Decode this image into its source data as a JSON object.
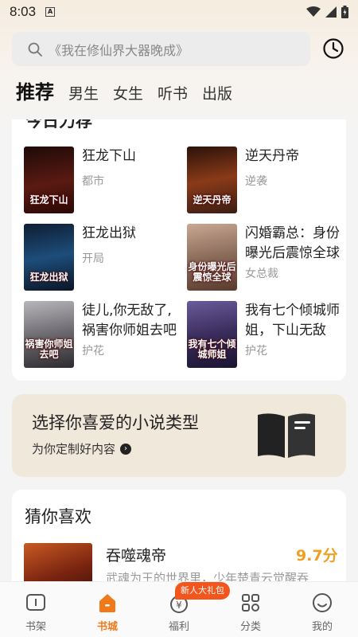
{
  "status_bar": {
    "time": "8:03"
  },
  "search": {
    "placeholder": "《我在修仙界大器晚成》"
  },
  "tabs": [
    {
      "label": "推荐",
      "active": true
    },
    {
      "label": "男生"
    },
    {
      "label": "女生"
    },
    {
      "label": "听书"
    },
    {
      "label": "出版"
    }
  ],
  "ranking": {
    "title": "今日力荐",
    "books": [
      {
        "title": "狂龙下山",
        "tag": "都市",
        "cover_text": "狂龙下山",
        "cover_color": "#5a1a12"
      },
      {
        "title": "逆天丹帝",
        "tag": "逆袭",
        "cover_text": "逆天丹帝",
        "cover_color": "#3b1d14"
      },
      {
        "title": "狂龙出狱",
        "tag": "开局",
        "cover_text": "狂龙出狱",
        "cover_color": "#1d4d7a"
      },
      {
        "title": "闪婚霸总：身份曝光后震惊全球",
        "tag": "女总裁",
        "cover_text": "身份曝光后震惊全球",
        "cover_color": "#8a6b5a"
      },
      {
        "title": "徒儿,你无敌了,祸害你师姐去吧",
        "tag": "护花",
        "cover_text": "祸害你师姐去吧",
        "cover_color": "#6c6a70"
      },
      {
        "title": "我有七个倾城师姐，下山无敌",
        "tag": "护花",
        "cover_text": "我有七个倾城师姐",
        "cover_color": "#3a2d5c"
      }
    ]
  },
  "banner": {
    "title": "选择你喜爱的小说类型",
    "subtitle": "为你定制好内容"
  },
  "recommend": {
    "title": "猜你喜欢",
    "book": {
      "title": "吞噬魂帝",
      "score": "9.7分",
      "desc": "武魂为王的世界里，少年楚青云觉醒吞"
    }
  },
  "bottom_nav": {
    "items": [
      {
        "label": "书架",
        "icon": "bookshelf-icon"
      },
      {
        "label": "书城",
        "icon": "bookstore-icon",
        "active": true
      },
      {
        "label": "福利",
        "icon": "welfare-icon"
      },
      {
        "label": "分类",
        "icon": "category-icon"
      },
      {
        "label": "我的",
        "icon": "profile-icon"
      }
    ],
    "badge": "新人大礼包"
  },
  "colors": {
    "accent": "#f07a1a",
    "score": "#f0a020",
    "badge": "#f2561d"
  }
}
